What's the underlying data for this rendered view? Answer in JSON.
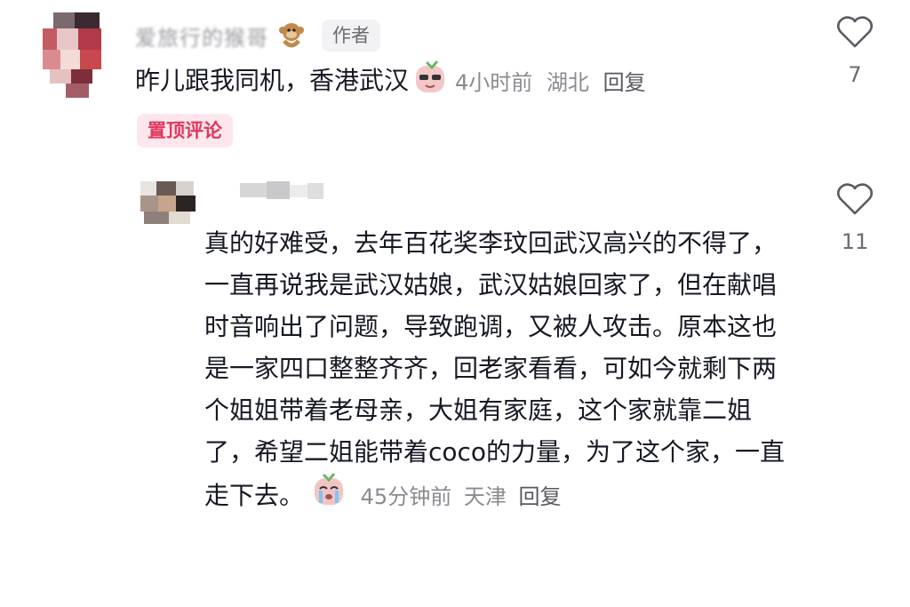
{
  "colors": {
    "text": "#161823",
    "meta": "#8a8b91",
    "pin_bg": "#fde7ec",
    "pin_text": "#e0375d",
    "badge_bg": "#f2f2f4"
  },
  "comment1": {
    "username": "爱旅行的猴哥",
    "author_badge": "作者",
    "text": "昨儿跟我同机，香港武汉",
    "time": "4小时前",
    "location": "湖北",
    "reply_label": "回复",
    "like_count": "7",
    "pin_label": "置顶评论",
    "icons": [
      "monkey-sticker-icon",
      "cool-emoji-sticker-icon",
      "heart-outline-icon"
    ]
  },
  "comment2": {
    "username": "",
    "text": "真的好难受，去年百花奖李玟回武汉高兴的不得了，一直再说我是武汉姑娘，武汉姑娘回家了，但在献唱时音响出了问题，导致跑调，又被人攻击。原本这也是一家四口整整齐齐，回老家看看，可如今就剩下两个姐姐带着老母亲，大姐有家庭，这个家就靠二姐了，希望二姐能带着coco的力量，为了这个家，一直走下去。",
    "time": "45分钟前",
    "location": "天津",
    "reply_label": "回复",
    "like_count": "11",
    "icons": [
      "crying-emoji-sticker-icon",
      "heart-outline-icon"
    ]
  }
}
